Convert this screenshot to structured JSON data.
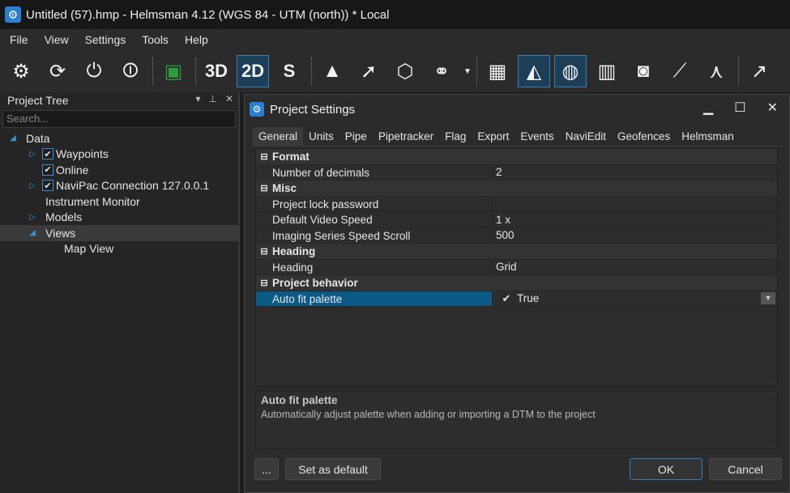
{
  "window": {
    "title": "Untitled (57).hmp - Helmsman 4.12 (WGS 84 - UTM (north)) * Local"
  },
  "menu": [
    "File",
    "View",
    "Settings",
    "Tools",
    "Help"
  ],
  "toolbar": {
    "btn_3d": "3D",
    "btn_2d": "2D",
    "btn_s": "S"
  },
  "project_tree": {
    "title": "Project Tree",
    "search_placeholder": "Search...",
    "items": [
      {
        "label": "Data"
      },
      {
        "label": "Waypoints"
      },
      {
        "label": "Online"
      },
      {
        "label": "NaviPac Connection 127.0.0.1"
      },
      {
        "label": "Instrument Monitor"
      },
      {
        "label": "Models"
      },
      {
        "label": "Views"
      },
      {
        "label": "Map View"
      }
    ]
  },
  "dialog": {
    "title": "Project Settings",
    "tabs": [
      "General",
      "Units",
      "Pipe",
      "Pipetracker",
      "Flag",
      "Export",
      "Events",
      "NaviEdit",
      "Geofences",
      "Helmsman"
    ],
    "categories": [
      {
        "name": "Format",
        "props": [
          {
            "name": "Number of decimals",
            "value": "2"
          }
        ]
      },
      {
        "name": "Misc",
        "props": [
          {
            "name": "Project lock password",
            "value": ""
          },
          {
            "name": "Default Video Speed",
            "value": "1 x"
          },
          {
            "name": "Imaging Series Speed Scroll",
            "value": "500"
          }
        ]
      },
      {
        "name": "Heading",
        "props": [
          {
            "name": "Heading",
            "value": "Grid"
          }
        ]
      },
      {
        "name": "Project behavior",
        "props": [
          {
            "name": "Auto fit palette",
            "value": "True"
          }
        ]
      }
    ],
    "description": {
      "title": "Auto fit palette",
      "text": "Automatically adjust palette when adding or importing a DTM to the project"
    },
    "buttons": {
      "ellipsis": "...",
      "set_default": "Set as default",
      "ok": "OK",
      "cancel": "Cancel"
    }
  }
}
